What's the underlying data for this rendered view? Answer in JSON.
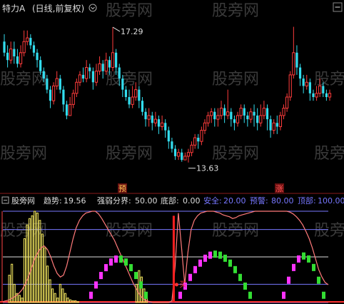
{
  "top_panel": {
    "title": "特力A",
    "subtitle": "(日线,前复权)",
    "watermark": "股旁网",
    "high_label": "17.29",
    "low_label": "13.63",
    "marker_yu": "预",
    "marker_zhang": "涨"
  },
  "bottom_panel": {
    "name": "股旁网",
    "trend_label": "趋势:",
    "trend_value": "19.56",
    "strong_weak_label": "强弱分界:",
    "strong_weak_value": "50.00",
    "bottom_label": "底部:",
    "bottom_value": "0.00",
    "safe_label": "安全:",
    "safe_value": "20.00",
    "warn_label": "预警:",
    "warn_value": "80.00",
    "top_label": "顶部:",
    "top_value": "100.00",
    "buy_label": "买"
  },
  "colors": {
    "up": "#ff3c3c",
    "down": "#33ddee",
    "trend_line": "#ff7a7a",
    "ref_line": "#7777ff",
    "yellow": "#f5e960",
    "magenta": "#ff33ff",
    "green": "#33dd33",
    "grid_text": "#cccccc"
  },
  "chart_data": [
    {
      "type": "candlestick",
      "title": "特力A (日线,前复权)",
      "ylim": [
        13.2,
        17.6
      ],
      "annotations": [
        {
          "label": "17.29",
          "index": 33,
          "value": 17.29
        },
        {
          "label": "13.63",
          "index": 56,
          "value": 13.63
        }
      ],
      "candles": [
        [
          16.9,
          16.6,
          17.1,
          16.5
        ],
        [
          16.6,
          16.4,
          16.8,
          16.2
        ],
        [
          16.4,
          16.7,
          16.9,
          16.3
        ],
        [
          16.7,
          16.5,
          16.9,
          16.3
        ],
        [
          16.5,
          16.3,
          16.7,
          16.2
        ],
        [
          16.3,
          16.6,
          16.8,
          16.2
        ],
        [
          16.6,
          16.9,
          17.2,
          16.5
        ],
        [
          16.9,
          17.0,
          17.2,
          16.8
        ],
        [
          17.0,
          16.8,
          17.1,
          16.7
        ],
        [
          16.8,
          16.6,
          16.9,
          16.5
        ],
        [
          16.6,
          16.4,
          16.7,
          16.2
        ],
        [
          16.4,
          16.1,
          16.5,
          16.0
        ],
        [
          16.1,
          15.9,
          16.2,
          15.8
        ],
        [
          15.9,
          15.6,
          16.0,
          15.5
        ],
        [
          15.6,
          15.3,
          15.7,
          15.1
        ],
        [
          15.3,
          15.7,
          15.8,
          15.2
        ],
        [
          15.7,
          15.9,
          16.1,
          15.6
        ],
        [
          15.9,
          15.6,
          16.0,
          15.5
        ],
        [
          15.6,
          15.2,
          15.7,
          15.0
        ],
        [
          15.2,
          14.9,
          15.3,
          14.8
        ],
        [
          14.9,
          15.2,
          15.4,
          14.9
        ],
        [
          15.2,
          15.5,
          15.6,
          15.1
        ],
        [
          15.5,
          15.8,
          15.9,
          15.4
        ],
        [
          15.8,
          16.0,
          16.1,
          15.7
        ],
        [
          16.0,
          15.9,
          16.2,
          15.8
        ],
        [
          15.9,
          16.2,
          16.4,
          15.8
        ],
        [
          16.2,
          16.1,
          16.3,
          15.9
        ],
        [
          16.1,
          15.8,
          16.2,
          15.6
        ],
        [
          15.8,
          16.1,
          16.3,
          15.7
        ],
        [
          16.1,
          16.3,
          16.5,
          16.0
        ],
        [
          16.3,
          16.1,
          16.4,
          15.9
        ],
        [
          16.1,
          16.4,
          16.6,
          16.0
        ],
        [
          16.4,
          16.2,
          16.5,
          16.0
        ],
        [
          16.2,
          16.6,
          17.29,
          16.1
        ],
        [
          16.6,
          16.2,
          16.7,
          16.0
        ],
        [
          16.2,
          15.9,
          16.3,
          15.7
        ],
        [
          15.9,
          15.6,
          16.0,
          15.4
        ],
        [
          15.6,
          15.4,
          15.7,
          15.3
        ],
        [
          15.4,
          15.2,
          15.6,
          15.1
        ],
        [
          15.2,
          15.4,
          15.7,
          15.1
        ],
        [
          15.4,
          15.6,
          15.8,
          15.3
        ],
        [
          15.6,
          15.3,
          15.7,
          15.1
        ],
        [
          15.3,
          15.0,
          15.4,
          14.9
        ],
        [
          15.0,
          14.8,
          15.1,
          14.6
        ],
        [
          14.8,
          14.9,
          15.1,
          14.6
        ],
        [
          14.9,
          14.7,
          15.0,
          14.5
        ],
        [
          14.7,
          14.8,
          15.0,
          14.6
        ],
        [
          14.8,
          14.6,
          14.9,
          14.4
        ],
        [
          14.6,
          14.7,
          14.9,
          14.5
        ],
        [
          14.7,
          14.5,
          14.8,
          14.3
        ],
        [
          14.5,
          14.2,
          14.6,
          14.0
        ],
        [
          14.2,
          14.0,
          14.3,
          13.9
        ],
        [
          14.0,
          13.8,
          14.1,
          13.7
        ],
        [
          13.8,
          13.9,
          14.0,
          13.7
        ],
        [
          13.9,
          13.7,
          14.0,
          13.65
        ],
        [
          13.7,
          13.8,
          13.9,
          13.7
        ],
        [
          13.8,
          13.9,
          14.0,
          13.63
        ],
        [
          13.9,
          14.1,
          14.2,
          13.8
        ],
        [
          14.1,
          14.3,
          14.4,
          14.0
        ],
        [
          14.3,
          14.2,
          14.4,
          14.0
        ],
        [
          14.2,
          14.5,
          14.6,
          14.1
        ],
        [
          14.5,
          14.7,
          14.8,
          14.4
        ],
        [
          14.7,
          14.9,
          15.0,
          14.6
        ],
        [
          14.9,
          15.0,
          15.1,
          14.7
        ],
        [
          15.0,
          14.8,
          15.1,
          14.6
        ],
        [
          14.8,
          14.9,
          15.1,
          14.6
        ],
        [
          14.9,
          15.1,
          15.3,
          14.8
        ],
        [
          15.1,
          14.9,
          15.2,
          14.7
        ],
        [
          14.9,
          15.0,
          15.6,
          14.8
        ],
        [
          15.0,
          14.8,
          15.1,
          14.6
        ],
        [
          14.8,
          14.7,
          14.9,
          14.5
        ],
        [
          14.7,
          14.9,
          15.0,
          14.6
        ],
        [
          14.9,
          15.1,
          15.2,
          14.8
        ],
        [
          15.1,
          14.9,
          15.2,
          14.7
        ],
        [
          14.9,
          14.8,
          15.0,
          14.6
        ],
        [
          14.8,
          15.0,
          15.1,
          14.7
        ],
        [
          15.0,
          14.9,
          15.2,
          14.6
        ],
        [
          14.9,
          14.7,
          15.1,
          14.5
        ],
        [
          14.7,
          14.9,
          15.2,
          14.6
        ],
        [
          14.9,
          15.1,
          15.3,
          14.8
        ],
        [
          15.1,
          14.8,
          15.2,
          14.5
        ],
        [
          14.8,
          14.5,
          14.9,
          14.3
        ],
        [
          14.5,
          14.7,
          14.8,
          14.4
        ],
        [
          14.7,
          14.6,
          14.9,
          14.4
        ],
        [
          14.6,
          14.9,
          15.0,
          14.5
        ],
        [
          14.9,
          15.1,
          15.2,
          14.8
        ],
        [
          15.1,
          15.4,
          15.5,
          15.0
        ],
        [
          15.4,
          16.0,
          16.1,
          15.3
        ],
        [
          16.0,
          16.6,
          17.3,
          15.9
        ],
        [
          16.6,
          16.2,
          16.8,
          16.0
        ],
        [
          16.2,
          15.9,
          16.3,
          15.7
        ],
        [
          15.9,
          15.7,
          16.0,
          15.5
        ],
        [
          15.7,
          15.8,
          16.0,
          15.6
        ],
        [
          15.8,
          15.5,
          15.9,
          15.3
        ],
        [
          15.5,
          15.4,
          15.6,
          15.3
        ],
        [
          15.4,
          15.5,
          15.7,
          15.3
        ],
        [
          15.5,
          15.7,
          15.9,
          15.4
        ],
        [
          15.7,
          15.5,
          15.8,
          15.4
        ],
        [
          15.5,
          15.4,
          15.6,
          15.3
        ],
        [
          15.4,
          15.5,
          15.6,
          15.3
        ]
      ]
    },
    {
      "type": "line",
      "title": "股旁网",
      "ylim": [
        0,
        100
      ],
      "reference_lines": [
        {
          "name": "顶部",
          "value": 100
        },
        {
          "name": "预警",
          "value": 80
        },
        {
          "name": "强弱分界",
          "value": 50
        },
        {
          "name": "安全",
          "value": 20
        },
        {
          "name": "底部",
          "value": 0
        }
      ],
      "series": [
        {
          "name": "趋势",
          "values": [
            1,
            2,
            3,
            5,
            7,
            10,
            14,
            20,
            28,
            38,
            48,
            55,
            60,
            62,
            58,
            50,
            40,
            32,
            28,
            30,
            40,
            55,
            70,
            82,
            90,
            95,
            98,
            99,
            100,
            100,
            97,
            92,
            86,
            80,
            74,
            68,
            60,
            52,
            44,
            36,
            28,
            20,
            14,
            8,
            4,
            2,
            1,
            0,
            0,
            0,
            0,
            0,
            0,
            2,
            40,
            98,
            60,
            20,
            55,
            80,
            90,
            95,
            98,
            99,
            100,
            100,
            100,
            99,
            98,
            96,
            95,
            94,
            92,
            93,
            95,
            96,
            97,
            98,
            99,
            100,
            100,
            100,
            100,
            100,
            100,
            100,
            100,
            100,
            100,
            100,
            99,
            97,
            94,
            90,
            85,
            78,
            70,
            60,
            48,
            36,
            28,
            22,
            19.56
          ]
        }
      ],
      "bars_yellow": [
        30,
        42,
        20,
        10,
        8,
        5,
        70,
        85,
        92,
        95,
        100,
        98,
        90,
        75,
        60,
        40,
        25,
        15,
        10,
        5,
        20,
        15,
        10,
        5,
        3,
        2,
        2,
        1,
        0,
        0,
        0,
        0,
        0,
        0,
        0,
        0,
        0,
        0,
        0,
        0,
        0,
        0,
        0,
        0,
        0,
        0,
        0,
        0,
        0,
        0,
        20,
        35,
        28,
        15,
        5
      ],
      "signal_oscillator": [
        {
          "label": "买",
          "index": 57
        }
      ]
    }
  ]
}
